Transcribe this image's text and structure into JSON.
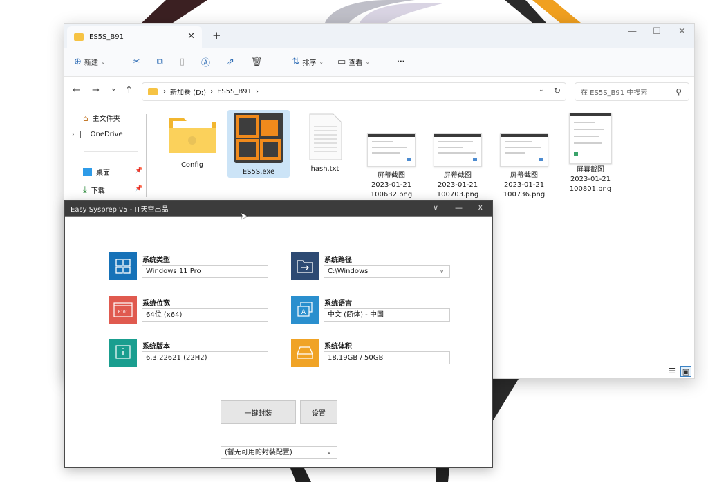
{
  "explorer": {
    "tab_title": "ES5S_B91",
    "tab_close": "✕",
    "new_tab": "+",
    "win_min": "—",
    "win_max": "☐",
    "win_close": "✕",
    "toolbar": {
      "new_label": "新建",
      "sort_label": "排序",
      "view_label": "查看",
      "more_label": "···"
    },
    "address": {
      "back": "←",
      "forward": "→",
      "recent": "⌄",
      "up": "↑",
      "sep1": "›",
      "drive": "新加卷 (D:)",
      "sep2": "›",
      "folder": "ES5S_B91",
      "sep3": "›",
      "dropdown": "⌄",
      "refresh": "↻",
      "search_placeholder": "在 ES5S_B91 中搜索"
    },
    "nav": {
      "home": "主文件夹",
      "onedrive": "OneDrive",
      "desktop": "桌面",
      "downloads": "下载"
    },
    "files": [
      {
        "name": "Config"
      },
      {
        "name": "ES5S.exe"
      },
      {
        "name": "hash.txt"
      },
      {
        "name": "屏幕截图\n2023-01-21\n100632.png"
      },
      {
        "name": "屏幕截图\n2023-01-21\n100703.png"
      },
      {
        "name": "屏幕截图\n2023-01-21\n100736.png"
      },
      {
        "name": "屏幕截图\n2023-01-21\n100801.png"
      }
    ]
  },
  "sysprep": {
    "title": "Easy Sysprep v5 - IT天空出品",
    "ctl_dropdown": "∨",
    "ctl_min": "—",
    "ctl_close": "X",
    "fields": {
      "sys_type": {
        "label": "系统类型",
        "value": "Windows 11 Pro"
      },
      "sys_path": {
        "label": "系统路径",
        "value": "C:\\Windows"
      },
      "sys_bits": {
        "label": "系统位宽",
        "value": "64位 (x64)"
      },
      "sys_lang": {
        "label": "系统语言",
        "value": "中文 (简体) - 中国"
      },
      "sys_ver": {
        "label": "系统版本",
        "value": "6.3.22621 (22H2)"
      },
      "sys_size": {
        "label": "系统体积",
        "value": "18.19GB / 50GB"
      }
    },
    "one_click_label": "一键封装",
    "settings_label": "设置",
    "config_select": "(暂无可用的封装配置)",
    "colors": {
      "blue": "#1672b8",
      "red": "#e05a4f",
      "teal": "#1a9e8f",
      "navy": "#2d4a73",
      "lightblue": "#2a8fce",
      "orange": "#f0a326"
    }
  }
}
